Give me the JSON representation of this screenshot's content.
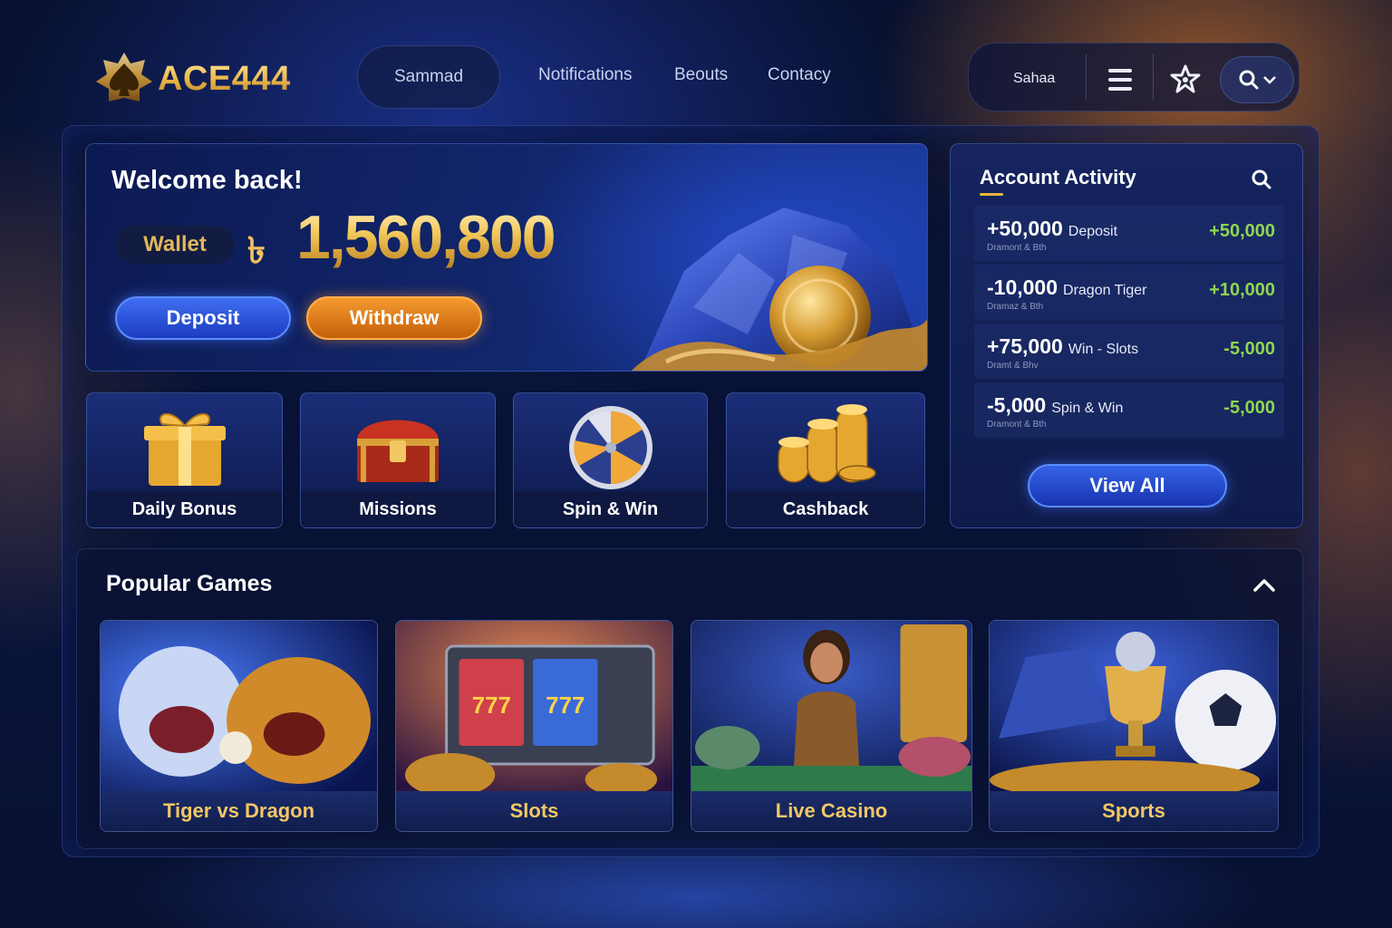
{
  "brand": {
    "name": "ACE444"
  },
  "nav": {
    "pill": "Sammad",
    "links": [
      "Notifications",
      "Beouts",
      "Contacy"
    ]
  },
  "header": {
    "user": "Sahaa",
    "icons": [
      "menu-icon",
      "star-icon",
      "search-icon",
      "chevron-down-icon"
    ]
  },
  "welcome": {
    "title": "Welcome back!",
    "wallet_label": "Wallet",
    "currency": "৳",
    "balance": "1,560,800",
    "deposit": "Deposit",
    "withdraw": "Withdraw"
  },
  "features": [
    {
      "label": "Daily Bonus",
      "icon": "gift-icon"
    },
    {
      "label": "Missions",
      "icon": "treasure-chest-icon"
    },
    {
      "label": "Spin & Win",
      "icon": "wheel-icon"
    },
    {
      "label": "Cashback",
      "icon": "coins-icon"
    }
  ],
  "activity": {
    "title": "Account Activity",
    "rows": [
      {
        "amount": "+50,000",
        "desc": "Deposit",
        "sub": "Dramont & Bth",
        "right": "+50,000"
      },
      {
        "amount": "-10,000",
        "desc": "Dragon Tiger",
        "sub": "Dramaz & Bth",
        "right": "+10,000"
      },
      {
        "amount": "+75,000",
        "desc": "Win - Slots",
        "sub": "Dramt & Bhv",
        "right": "-5,000"
      },
      {
        "amount": "-5,000",
        "desc": "Spin & Win",
        "sub": "Dramont & Bth",
        "right": "-5,000"
      }
    ],
    "view_all": "View All",
    "colors": {
      "positive": "#8fd651"
    }
  },
  "popular": {
    "title": "Popular Games",
    "games": [
      {
        "label": "Tiger vs Dragon"
      },
      {
        "label": "Slots"
      },
      {
        "label": "Live Casino"
      },
      {
        "label": "Sports"
      }
    ]
  },
  "theme": {
    "accent_gold": "#f3c764",
    "accent_blue": "#3463e6",
    "accent_orange": "#f59a2e"
  }
}
